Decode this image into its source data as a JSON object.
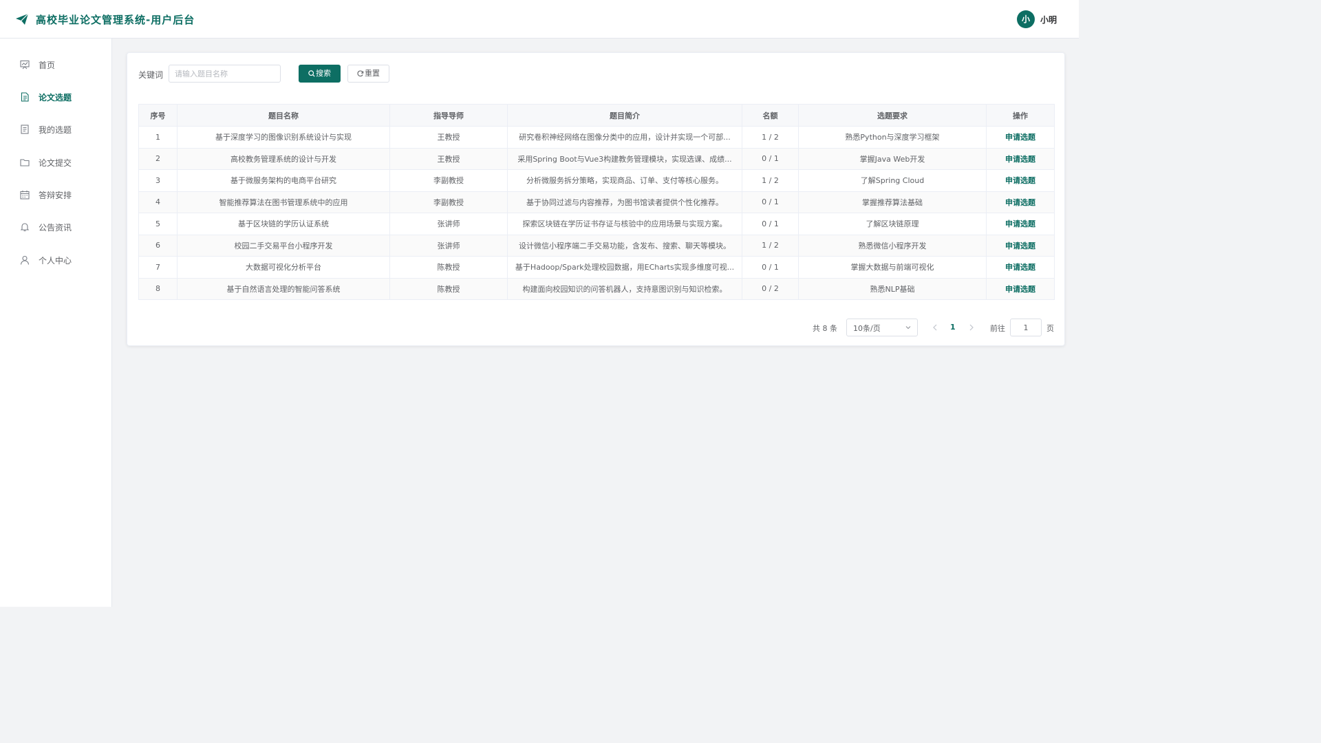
{
  "header": {
    "title": "高校毕业论文管理系统-用户后台",
    "avatar_text": "小",
    "username": "小明"
  },
  "sidebar": {
    "items": [
      {
        "label": "首页",
        "icon": "dashboard-icon",
        "active": false
      },
      {
        "label": "论文选题",
        "icon": "document-icon",
        "active": true
      },
      {
        "label": "我的选题",
        "icon": "list-icon",
        "active": false
      },
      {
        "label": "论文提交",
        "icon": "folder-icon",
        "active": false
      },
      {
        "label": "答辩安排",
        "icon": "calendar-icon",
        "active": false
      },
      {
        "label": "公告资讯",
        "icon": "bell-icon",
        "active": false
      },
      {
        "label": "个人中心",
        "icon": "user-icon",
        "active": false
      }
    ]
  },
  "search": {
    "label": "关键词",
    "placeholder": "请输入题目名称",
    "value": "",
    "search_button": "搜索",
    "reset_button": "重置"
  },
  "table": {
    "columns": [
      "序号",
      "题目名称",
      "指导导师",
      "题目简介",
      "名额",
      "选题要求",
      "操作"
    ],
    "rows": [
      [
        "1",
        "基于深度学习的图像识别系统设计与实现",
        "王教授",
        "研究卷积神经网络在图像分类中的应用，设计并实现一个可部...",
        "1 / 2",
        "熟悉Python与深度学习框架",
        "申请选题"
      ],
      [
        "2",
        "高校教务管理系统的设计与开发",
        "王教授",
        "采用Spring Boot与Vue3构建教务管理模块，实现选课、成绩...",
        "0 / 1",
        "掌握Java Web开发",
        "申请选题"
      ],
      [
        "3",
        "基于微服务架构的电商平台研究",
        "李副教授",
        "分析微服务拆分策略，实现商品、订单、支付等核心服务。",
        "1 / 2",
        "了解Spring Cloud",
        "申请选题"
      ],
      [
        "4",
        "智能推荐算法在图书管理系统中的应用",
        "李副教授",
        "基于协同过滤与内容推荐，为图书馆读者提供个性化推荐。",
        "0 / 1",
        "掌握推荐算法基础",
        "申请选题"
      ],
      [
        "5",
        "基于区块链的学历认证系统",
        "张讲师",
        "探索区块链在学历证书存证与核验中的应用场景与实现方案。",
        "0 / 1",
        "了解区块链原理",
        "申请选题"
      ],
      [
        "6",
        "校园二手交易平台小程序开发",
        "张讲师",
        "设计微信小程序端二手交易功能，含发布、搜索、聊天等模块。",
        "1 / 2",
        "熟悉微信小程序开发",
        "申请选题"
      ],
      [
        "7",
        "大数据可视化分析平台",
        "陈教授",
        "基于Hadoop/Spark处理校园数据，用ECharts实现多维度可视...",
        "0 / 1",
        "掌握大数据与前端可视化",
        "申请选题"
      ],
      [
        "8",
        "基于自然语言处理的智能问答系统",
        "陈教授",
        "构建面向校园知识的问答机器人，支持意图识别与知识检索。",
        "0 / 2",
        "熟悉NLP基础",
        "申请选题"
      ]
    ]
  },
  "pagination": {
    "total_text": "共 8 条",
    "page_size": "10条/页",
    "current_page": "1",
    "goto_label": "前往",
    "goto_value": "1",
    "page_unit": "页"
  },
  "colors": {
    "primary": "#0d6e63",
    "border": "#ebeef5",
    "header_bg": "#f7f8fa"
  }
}
